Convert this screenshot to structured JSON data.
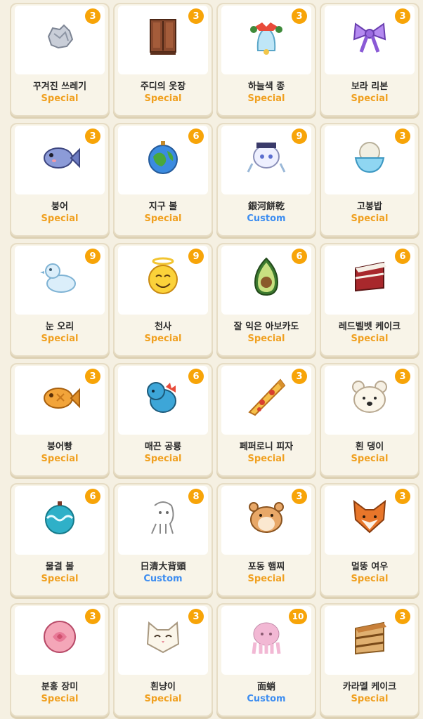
{
  "colors": {
    "special": "#f0a020",
    "custom": "#3d8df0",
    "badge": "#f7a408"
  },
  "items": [
    {
      "name": "꾸겨진 쓰레기",
      "tag": "Special",
      "count": "3",
      "icon": "crumpled-paper-icon"
    },
    {
      "name": "주디의 옷장",
      "tag": "Special",
      "count": "3",
      "icon": "wardrobe-icon"
    },
    {
      "name": "하늘색 종",
      "tag": "Special",
      "count": "3",
      "icon": "bell-icon"
    },
    {
      "name": "보라 리본",
      "tag": "Special",
      "count": "3",
      "icon": "ribbon-icon"
    },
    {
      "name": "붕어",
      "tag": "Special",
      "count": "3",
      "icon": "fish-icon"
    },
    {
      "name": "지구 볼",
      "tag": "Special",
      "count": "6",
      "icon": "earth-ornament-icon"
    },
    {
      "name": "銀河餅乾",
      "tag": "Custom",
      "count": "9",
      "icon": "anime-character-icon"
    },
    {
      "name": "고봉밥",
      "tag": "Special",
      "count": "3",
      "icon": "rice-bowl-icon"
    },
    {
      "name": "눈 오리",
      "tag": "Special",
      "count": "9",
      "icon": "snow-duck-icon"
    },
    {
      "name": "천사",
      "tag": "Special",
      "count": "9",
      "icon": "angel-emoji-icon"
    },
    {
      "name": "잘 익은 아보카도",
      "tag": "Special",
      "count": "6",
      "icon": "avocado-icon"
    },
    {
      "name": "레드벨벳 케이크",
      "tag": "Special",
      "count": "6",
      "icon": "red-velvet-cake-icon"
    },
    {
      "name": "붕어빵",
      "tag": "Special",
      "count": "3",
      "icon": "fish-bread-icon"
    },
    {
      "name": "매끈 공룡",
      "tag": "Special",
      "count": "6",
      "icon": "dinosaur-icon"
    },
    {
      "name": "페퍼로니 피자",
      "tag": "Special",
      "count": "3",
      "icon": "pizza-icon"
    },
    {
      "name": "흰 댕이",
      "tag": "Special",
      "count": "3",
      "icon": "white-dog-icon"
    },
    {
      "name": "물결 볼",
      "tag": "Special",
      "count": "6",
      "icon": "wave-ornament-icon"
    },
    {
      "name": "日清大背頭",
      "tag": "Custom",
      "count": "8",
      "icon": "sketch-character-icon"
    },
    {
      "name": "포동 햄찌",
      "tag": "Special",
      "count": "3",
      "icon": "hamster-icon"
    },
    {
      "name": "멀뚱 여우",
      "tag": "Special",
      "count": "3",
      "icon": "fox-icon"
    },
    {
      "name": "분홍 장미",
      "tag": "Special",
      "count": "3",
      "icon": "rose-icon"
    },
    {
      "name": "흰냥이",
      "tag": "Special",
      "count": "3",
      "icon": "white-cat-icon"
    },
    {
      "name": "面蛸",
      "tag": "Custom",
      "count": "10",
      "icon": "octopus-icon"
    },
    {
      "name": "카라멜 케이크",
      "tag": "Special",
      "count": "3",
      "icon": "caramel-cake-icon"
    }
  ]
}
